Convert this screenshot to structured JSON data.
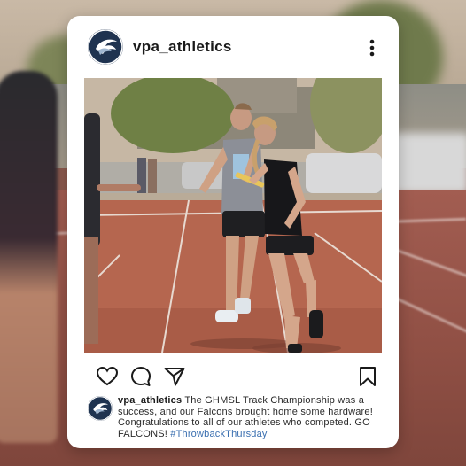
{
  "post": {
    "username": "vpa_athletics",
    "caption_user": "vpa_athletics",
    "caption_text": " The GHMSL Track Championship was a success, and our Falcons brought home some hardware! Congratulations to all of our athletes who competed. GO FALCONS! ",
    "hashtag": "#ThrowbackThursday"
  },
  "icons": {
    "avatar": "falcon-logo",
    "more": "vertical-ellipsis-icon",
    "like": "heart-icon",
    "comment": "speech-bubble-icon",
    "share": "paper-plane-icon",
    "save": "bookmark-icon"
  },
  "colors": {
    "card": "#ffffff",
    "logo_bg": "#1f3350",
    "hashtag": "#3a6fb0",
    "track": "#a25d51"
  }
}
